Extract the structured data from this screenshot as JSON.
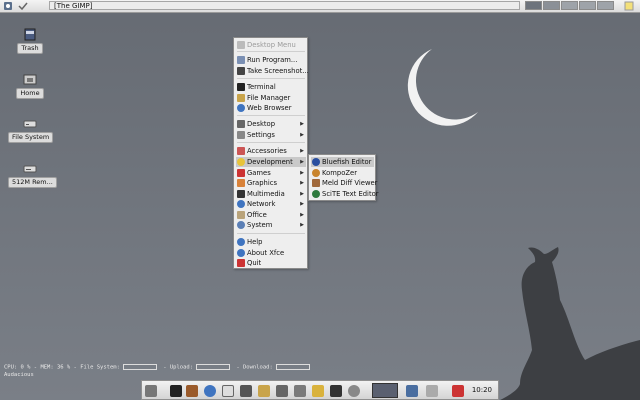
{
  "colors": {
    "desktop_bg": "#6f747c",
    "moon": "#f2f2f2",
    "silhouette": "#3d3f43",
    "menu_bg": "#eeeeee",
    "highlight": "#c9c9c9"
  },
  "top_panel": {
    "window_title": "[The GIMP]",
    "left_icons": [
      "xfce-menu-icon",
      "check-icon"
    ],
    "right_icons": [
      "workspace-switcher",
      "notes-icon"
    ]
  },
  "desktop_icons": [
    {
      "label": "Trash",
      "icon": "trash-icon"
    },
    {
      "label": "Home",
      "icon": "home-folder-icon"
    },
    {
      "label": "File System",
      "icon": "drive-icon"
    },
    {
      "label": "512M Rem...",
      "icon": "removable-drive-icon"
    }
  ],
  "menu": {
    "header": "Desktop Menu",
    "items": [
      {
        "label": "Run Program...",
        "icon": "run-icon"
      },
      {
        "label": "Take Screenshot...",
        "icon": "camera-icon"
      },
      {
        "label": "Terminal",
        "icon": "terminal-icon"
      },
      {
        "label": "File Manager",
        "icon": "file-manager-icon"
      },
      {
        "label": "Web Browser",
        "icon": "globe-icon"
      },
      {
        "label": "Desktop",
        "icon": "desktop-icon"
      },
      {
        "label": "Settings",
        "icon": "settings-icon"
      },
      {
        "label": "Accessories",
        "icon": "accessories-icon"
      },
      {
        "label": "Development",
        "icon": "development-icon"
      },
      {
        "label": "Games",
        "icon": "games-icon"
      },
      {
        "label": "Graphics",
        "icon": "graphics-icon"
      },
      {
        "label": "Multimedia",
        "icon": "multimedia-icon"
      },
      {
        "label": "Network",
        "icon": "network-icon"
      },
      {
        "label": "Office",
        "icon": "office-icon"
      },
      {
        "label": "System",
        "icon": "system-icon"
      },
      {
        "label": "Help",
        "icon": "help-icon"
      },
      {
        "label": "About Xfce",
        "icon": "info-icon"
      },
      {
        "label": "Quit",
        "icon": "quit-icon"
      }
    ]
  },
  "submenu": {
    "items": [
      {
        "label": "Bluefish Editor",
        "icon": "bluefish-icon"
      },
      {
        "label": "KompoZer",
        "icon": "kompozer-icon"
      },
      {
        "label": "Meld Diff Viewer",
        "icon": "meld-icon"
      },
      {
        "label": "SciTE Text Editor",
        "icon": "scite-icon"
      }
    ]
  },
  "monitor": {
    "cpu": "CPU: 0 %",
    "mem": "MEM: 36 %",
    "fs": "File System:",
    "upload": "Upload:",
    "download": "Download:",
    "app": "Audacious"
  },
  "bottom_panel": {
    "icons": [
      "xfce-logo-icon",
      "terminal-icon",
      "book-icon",
      "globe-icon",
      "windows-icon",
      "edit-icon",
      "tools-icon",
      "font-icon",
      "script-icon",
      "music-icon",
      "film-icon",
      "gear-icon"
    ],
    "clock": "10:20"
  }
}
